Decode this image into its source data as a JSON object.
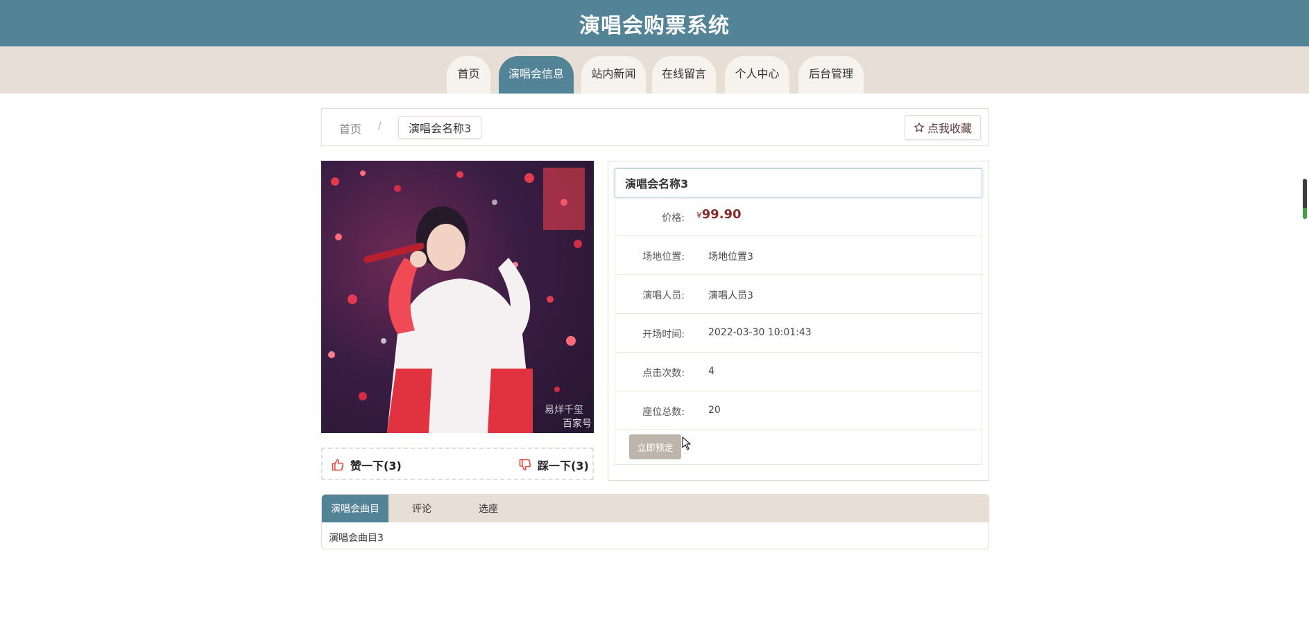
{
  "header": {
    "title": "演唱会购票系统"
  },
  "nav": {
    "items": [
      {
        "label": "首页"
      },
      {
        "label": "演唱会信息"
      },
      {
        "label": "站内新闻"
      },
      {
        "label": "在线留言"
      },
      {
        "label": "个人中心"
      },
      {
        "label": "后台管理"
      }
    ],
    "active_index": 1
  },
  "breadcrumb": {
    "home": "首页",
    "separator": "/",
    "current": "演唱会名称3"
  },
  "favorite": {
    "label": "点我收藏",
    "icon": "star-icon"
  },
  "poster": {
    "watermark_line1": "易烊千玺",
    "watermark_line2": "百家号"
  },
  "votes": {
    "like": {
      "label": "赞一下(3)",
      "icon": "thumbs-up-icon"
    },
    "dislike": {
      "label": "踩一下(3)",
      "icon": "thumbs-down-icon"
    }
  },
  "detail": {
    "title": "演唱会名称3",
    "price_label": "价格:",
    "currency": "¥",
    "price": "99.90",
    "rows": [
      {
        "label": "场地位置:",
        "value": "场地位置3"
      },
      {
        "label": "演唱人员:",
        "value": "演唱人员3"
      },
      {
        "label": "开场时间:",
        "value": "2022-03-30 10:01:43"
      },
      {
        "label": "点击次数:",
        "value": "4"
      },
      {
        "label": "座位总数:",
        "value": "20"
      }
    ],
    "book_label": "立即预定"
  },
  "tabs": {
    "items": [
      {
        "label": "演唱会曲目"
      },
      {
        "label": "评论"
      },
      {
        "label": "选座"
      }
    ],
    "active_index": 0,
    "content": "演唱会曲目3"
  },
  "colors": {
    "primary": "#528397",
    "nav_bg": "#e7dfd5",
    "price": "#8a2c2c",
    "book_button": "#bdb5ac"
  }
}
